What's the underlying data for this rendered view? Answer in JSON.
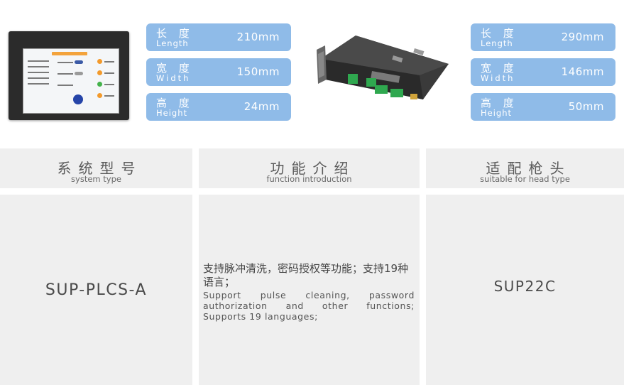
{
  "left_specs": [
    {
      "zh": "长 度",
      "en": "Length",
      "value": "210mm"
    },
    {
      "zh": "宽 度",
      "en": "Width",
      "value": "150mm"
    },
    {
      "zh": "高 度",
      "en": "Height",
      "value": "24mm"
    }
  ],
  "right_specs": [
    {
      "zh": "长 度",
      "en": "Length",
      "value": "290mm"
    },
    {
      "zh": "宽 度",
      "en": "Width",
      "value": "146mm"
    },
    {
      "zh": "高 度",
      "en": "Height",
      "value": "50mm"
    }
  ],
  "table": {
    "headers": [
      {
        "zh": "系统型号",
        "en": "system type"
      },
      {
        "zh": "功能介绍",
        "en": "function introduction"
      },
      {
        "zh": "适配枪头",
        "en": "suitable for head type"
      }
    ],
    "row": {
      "model": "SUP-PLCS-A",
      "function_zh": "支持脉冲清洗，密码授权等功能；支持19种语言；",
      "function_en": "Support pulse cleaning, password authorization and other functions; Supports 19 languages;",
      "head_type": "SUP22C"
    }
  },
  "colors": {
    "spec_badge": "#8fbbe8",
    "table_cell": "#efefef",
    "device_dark": "#2b2b2b",
    "terminal_green": "#2fa84f"
  }
}
